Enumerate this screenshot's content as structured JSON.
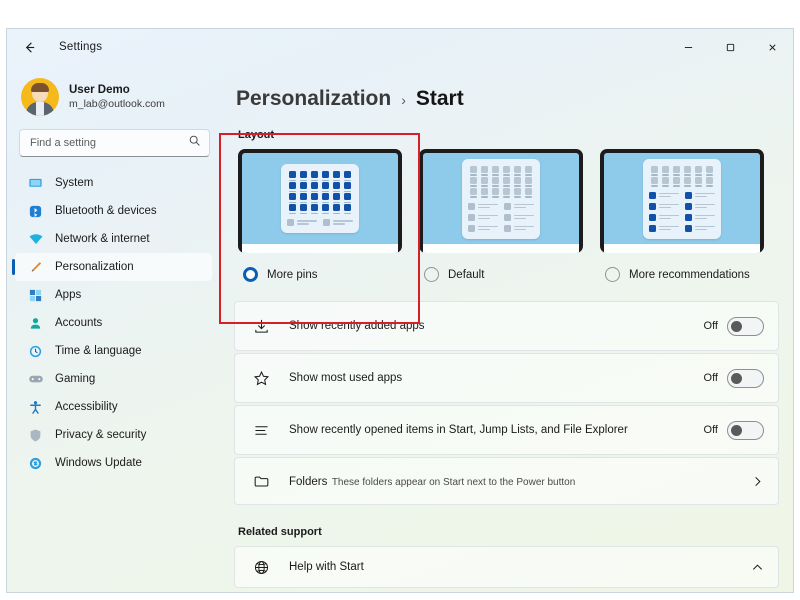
{
  "window": {
    "app_title": "Settings",
    "back_icon": "arrow-left-icon",
    "controls": [
      {
        "name": "minimize",
        "glyph": "–"
      },
      {
        "name": "maximize",
        "glyph": "□"
      },
      {
        "name": "close",
        "glyph": "✕"
      }
    ]
  },
  "sidebar": {
    "account": {
      "name": "User Demo",
      "email": "m_lab@outlook.com"
    },
    "search": {
      "placeholder": "Find a setting",
      "value": "",
      "icon": "search-icon"
    },
    "items": [
      {
        "label": "System",
        "icon": "monitor-icon",
        "selected": false
      },
      {
        "label": "Bluetooth & devices",
        "icon": "bluetooth-icon",
        "selected": false
      },
      {
        "label": "Network & internet",
        "icon": "wifi-icon",
        "selected": false
      },
      {
        "label": "Personalization",
        "icon": "paintbrush-icon",
        "selected": true
      },
      {
        "label": "Apps",
        "icon": "apps-icon",
        "selected": false
      },
      {
        "label": "Accounts",
        "icon": "person-icon",
        "selected": false
      },
      {
        "label": "Time & language",
        "icon": "clock-icon",
        "selected": false
      },
      {
        "label": "Gaming",
        "icon": "gamepad-icon",
        "selected": false
      },
      {
        "label": "Accessibility",
        "icon": "accessibility-icon",
        "selected": false
      },
      {
        "label": "Privacy & security",
        "icon": "shield-icon",
        "selected": false
      },
      {
        "label": "Windows Update",
        "icon": "update-icon",
        "selected": false
      }
    ]
  },
  "breadcrumb": {
    "parent": "Personalization",
    "separator": "›",
    "current": "Start"
  },
  "layout": {
    "heading": "Layout",
    "options": [
      {
        "label": "More pins",
        "selected": true,
        "pin_rows": 4,
        "pin_cols": 6,
        "pin_color": "blue",
        "rec_rows": 1,
        "rec_color": "grey"
      },
      {
        "label": "Default",
        "selected": false,
        "pin_rows": 3,
        "pin_cols": 6,
        "pin_color": "grey",
        "rec_rows": 3,
        "rec_color": "grey"
      },
      {
        "label": "More recommendations",
        "selected": false,
        "pin_rows": 2,
        "pin_cols": 6,
        "pin_color": "grey",
        "rec_rows": 4,
        "rec_color": "blue"
      }
    ]
  },
  "settings_rows": [
    {
      "title": "Show recently added apps",
      "sub": "",
      "icon": "download-icon",
      "control": "toggle",
      "state": "Off"
    },
    {
      "title": "Show most used apps",
      "sub": "",
      "icon": "star-icon",
      "control": "toggle",
      "state": "Off"
    },
    {
      "title": "Show recently opened items in Start, Jump Lists, and File Explorer",
      "sub": "",
      "icon": "list-icon",
      "control": "toggle",
      "state": "Off"
    },
    {
      "title": "Folders",
      "sub": "These folders appear on Start next to the Power button",
      "icon": "folder-icon",
      "control": "chevron-right",
      "state": ""
    }
  ],
  "related_support": {
    "heading": "Related support",
    "item": {
      "title": "Help with Start",
      "icon": "globe-icon",
      "chevron": "chevron-up-icon"
    }
  },
  "annotation": {
    "highlight_color": "#d81f27"
  }
}
